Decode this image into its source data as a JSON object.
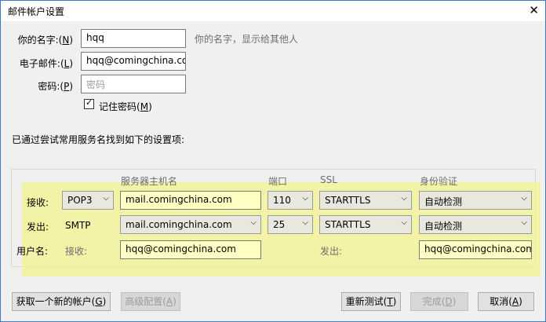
{
  "window": {
    "title": "邮件帐户设置"
  },
  "form": {
    "name_label": "你的名字:",
    "name_accel": "N",
    "name_value": "hqq",
    "name_hint": "你的名字，显示给其他人",
    "email_label": "电子邮件:",
    "email_accel": "L",
    "email_value": "hqq@comingchina.com",
    "password_label": "密码:",
    "password_accel": "P",
    "password_placeholder": "密码",
    "remember_label": "记住密码",
    "remember_accel": "M",
    "remember_checked": true
  },
  "status": "已通过尝试常用服务名找到如下的设置项:",
  "servers": {
    "col_hostname": "服务器主机名",
    "col_port": "端口",
    "col_ssl": "SSL",
    "col_auth": "身份验证",
    "incoming": {
      "label": "接收:",
      "protocol": "POP3",
      "hostname": "mail.comingchina.com",
      "port": "110",
      "ssl": "STARTTLS",
      "auth": "自动检测"
    },
    "outgoing": {
      "label": "发出:",
      "protocol": "SMTP",
      "hostname": "mail.comingchina.com",
      "port": "25",
      "ssl": "STARTTLS",
      "auth": "自动检测"
    },
    "username": {
      "label": "用户名:",
      "incoming_label": "接收:",
      "incoming_value": "hqq@comingchina.com",
      "outgoing_label": "发出:",
      "outgoing_value": "hqq@comingchina.com"
    }
  },
  "buttons": {
    "new_account": "获取一个新的帐户",
    "new_account_accel": "G",
    "advanced": "高级配置",
    "advanced_accel": "A",
    "retest": "重新测试",
    "retest_accel": "T",
    "done": "完成",
    "done_accel": "D",
    "cancel": "取消",
    "cancel_accel": "A"
  },
  "colors": {
    "highlight": "#f4f48a",
    "field_highlight": "#ffffc4",
    "window_border": "#3a79c6"
  }
}
